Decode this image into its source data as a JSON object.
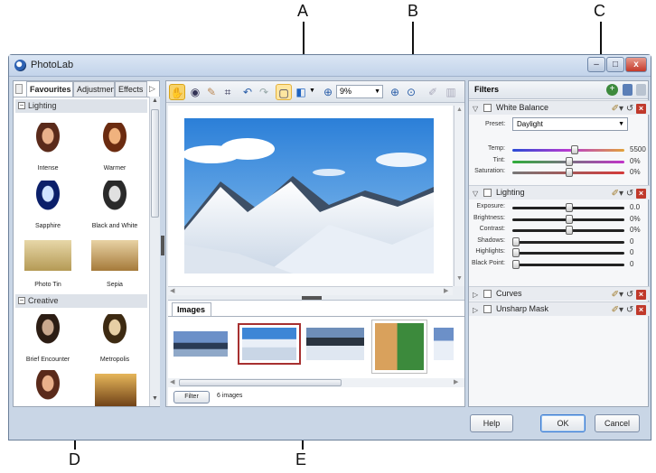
{
  "callouts": {
    "a": "A",
    "b": "B",
    "c": "C",
    "d": "D",
    "e": "E"
  },
  "window": {
    "title": "PhotoLab",
    "min": "–",
    "max": "□",
    "close": "x"
  },
  "left_panel": {
    "tabs": [
      "Favourites",
      "Adjustmen",
      "Effects"
    ],
    "groups": [
      {
        "label": "Lighting",
        "items": [
          "Intense",
          "Warmer",
          "Sapphire",
          "Black and White",
          "Photo Tin",
          "Sepia"
        ]
      },
      {
        "label": "Creative",
        "items": [
          "Brief Encounter",
          "Metropolis"
        ]
      }
    ]
  },
  "toolbar": {
    "zoom_value": "9%"
  },
  "images_panel": {
    "tab_label": "Images",
    "filter_button": "Filter",
    "count_label": "6 images"
  },
  "filters_panel": {
    "title": "Filters",
    "white_balance": {
      "label": "White Balance",
      "preset_label": "Preset:",
      "preset_value": "Daylight",
      "sliders": [
        {
          "label": "Temp:",
          "value": "5500",
          "level": 0.55
        },
        {
          "label": "Tint:",
          "value": "0%",
          "level": 0.5
        },
        {
          "label": "Saturation:",
          "value": "0%",
          "level": 0.5
        }
      ]
    },
    "lighting": {
      "label": "Lighting",
      "sliders": [
        {
          "label": "Exposure:",
          "value": "0.0",
          "level": 0.5
        },
        {
          "label": "Brightness:",
          "value": "0%",
          "level": 0.5
        },
        {
          "label": "Contrast:",
          "value": "0%",
          "level": 0.5
        },
        {
          "label": "Shadows:",
          "value": "0",
          "level": 0.0
        },
        {
          "label": "Highlights:",
          "value": "0",
          "level": 0.0
        },
        {
          "label": "Black Point:",
          "value": "0",
          "level": 0.0
        }
      ]
    },
    "curves": {
      "label": "Curves"
    },
    "unsharp_mask": {
      "label": "Unsharp Mask"
    }
  },
  "footer": {
    "help": "Help",
    "ok": "OK",
    "cancel": "Cancel"
  }
}
